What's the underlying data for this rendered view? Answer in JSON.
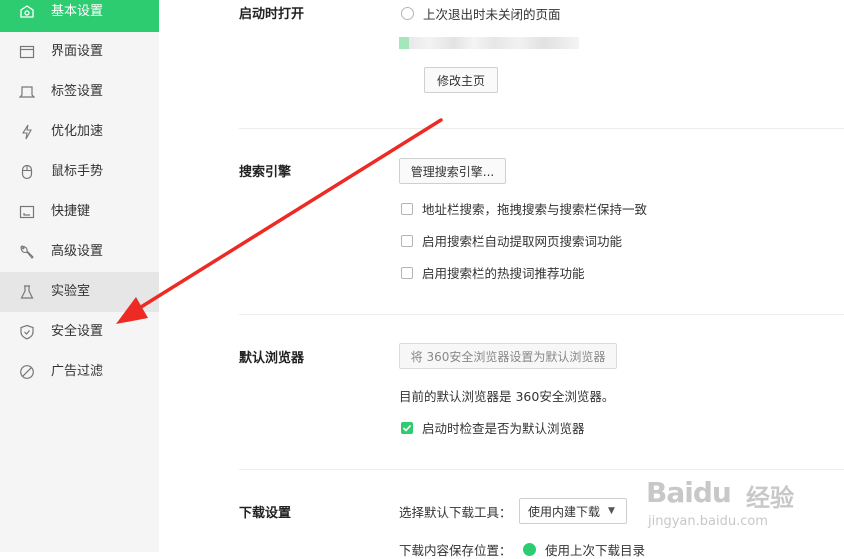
{
  "sidebar": {
    "items": [
      {
        "label": "基本设置",
        "icon": "home-icon"
      },
      {
        "label": "界面设置",
        "icon": "window-icon"
      },
      {
        "label": "标签设置",
        "icon": "tab-icon"
      },
      {
        "label": "优化加速",
        "icon": "lightning-icon"
      },
      {
        "label": "鼠标手势",
        "icon": "mouse-icon"
      },
      {
        "label": "快捷键",
        "icon": "keyboard-icon"
      },
      {
        "label": "高级设置",
        "icon": "wrench-icon"
      },
      {
        "label": "实验室",
        "icon": "flask-icon"
      },
      {
        "label": "安全设置",
        "icon": "shield-icon"
      },
      {
        "label": "广告过滤",
        "icon": "block-icon"
      }
    ]
  },
  "startup": {
    "title": "启动时打开",
    "option_restore": "上次退出时未关闭的页面",
    "change_home_btn": "修改主页"
  },
  "search": {
    "title": "搜索引擎",
    "manage_btn": "管理搜索引擎...",
    "opt1": "地址栏搜索，拖拽搜索与搜索栏保持一致",
    "opt2": "启用搜索栏自动提取网页搜索词功能",
    "opt3": "启用搜索栏的热搜词推荐功能"
  },
  "default_browser": {
    "title": "默认浏览器",
    "set_default_btn": "将 360安全浏览器设置为默认浏览器",
    "status": "目前的默认浏览器是 360安全浏览器。",
    "check_on_start": "启动时检查是否为默认浏览器"
  },
  "download": {
    "title": "下载设置",
    "tool_label": "选择默认下载工具：",
    "tool_value": "使用内建下载",
    "location_label": "下载内容保存位置：",
    "location_value": "使用上次下载目录"
  },
  "watermark": {
    "brand": "Baidu",
    "cn": "经验",
    "url": "jingyan.baidu.com"
  },
  "colors": {
    "accent": "#2ecc71",
    "arrow": "#ee2a24"
  }
}
